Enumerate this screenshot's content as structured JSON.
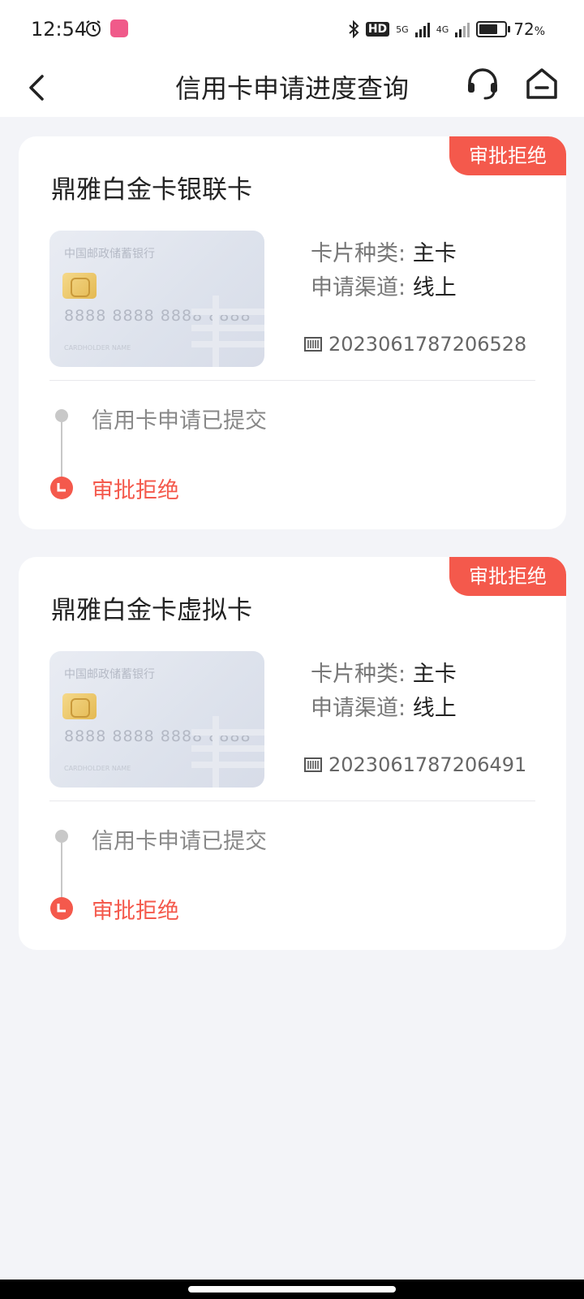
{
  "status_bar": {
    "time": "12:54",
    "hd_label": "HD",
    "net1": "5G",
    "net2": "4G",
    "battery": "72",
    "battery_unit": "%"
  },
  "nav": {
    "title": "信用卡申请进度查询"
  },
  "cards": [
    {
      "status": "审批拒绝",
      "name": "鼎雅白金卡银联卡",
      "card_face": {
        "bank": "中国邮政储蓄银行",
        "number": "8888 8888 8888 8888",
        "holder": "CARDHOLDER NAME"
      },
      "type_label": "卡片种类:",
      "type_value": "主卡",
      "channel_label": "申请渠道:",
      "channel_value": "线上",
      "app_no": "2023061787206528",
      "steps": [
        "信用卡申请已提交",
        "审批拒绝"
      ]
    },
    {
      "status": "审批拒绝",
      "name": "鼎雅白金卡虚拟卡",
      "card_face": {
        "bank": "中国邮政储蓄银行",
        "number": "8888 8888 8888 8888",
        "holder": "CARDHOLDER NAME"
      },
      "type_label": "卡片种类:",
      "type_value": "主卡",
      "channel_label": "申请渠道:",
      "channel_value": "线上",
      "app_no": "2023061787206491",
      "steps": [
        "信用卡申请已提交",
        "审批拒绝"
      ]
    }
  ],
  "colors": {
    "accent": "#f4594c",
    "background": "#f3f4f8",
    "timeline_gray": "#c8c8c8"
  }
}
